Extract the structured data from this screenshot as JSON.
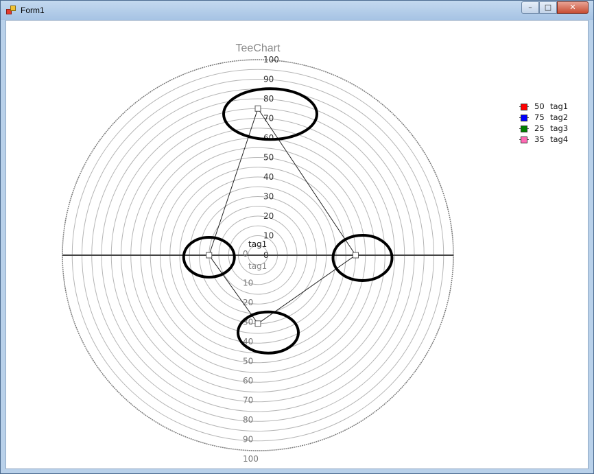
{
  "window": {
    "title": "Form1",
    "controls": {
      "minimize": "–",
      "maximize": "□",
      "close": "✕"
    }
  },
  "chart_data": {
    "type": "radar",
    "title": "TeeChart",
    "radial_axis": {
      "min": 0,
      "max": 100,
      "step": 10,
      "upper_ticks": [
        "100",
        "90",
        "80",
        "70",
        "60",
        "50",
        "40",
        "30",
        "20",
        "10",
        "0"
      ],
      "lower_ticks": [
        "0",
        "10",
        "20",
        "30",
        "40",
        "50",
        "60",
        "70",
        "80",
        "90",
        "100"
      ]
    },
    "center_labels": {
      "upper": "tag1",
      "lower": "tag1"
    },
    "series": [
      {
        "name": "tag2",
        "angle": "top",
        "value": 75,
        "color": "#0000ff"
      },
      {
        "name": "tag1",
        "angle": "right",
        "value": 50,
        "color": "#ff0000"
      },
      {
        "name": "tag4",
        "angle": "bottom",
        "value": 35,
        "color": "#ff69b4"
      },
      {
        "name": "tag3",
        "angle": "left",
        "value": 25,
        "color": "#008000"
      }
    ],
    "legend": [
      {
        "value": "50",
        "label": "tag1",
        "color": "#ff0000"
      },
      {
        "value": "75",
        "label": "tag2",
        "color": "#0000ff"
      },
      {
        "value": "25",
        "label": "tag3",
        "color": "#008000"
      },
      {
        "value": "35",
        "label": "tag4",
        "color": "#ff69b4"
      }
    ],
    "legend_position": "top-right",
    "grid": true,
    "highlight_markers": "ellipses around each data point"
  }
}
